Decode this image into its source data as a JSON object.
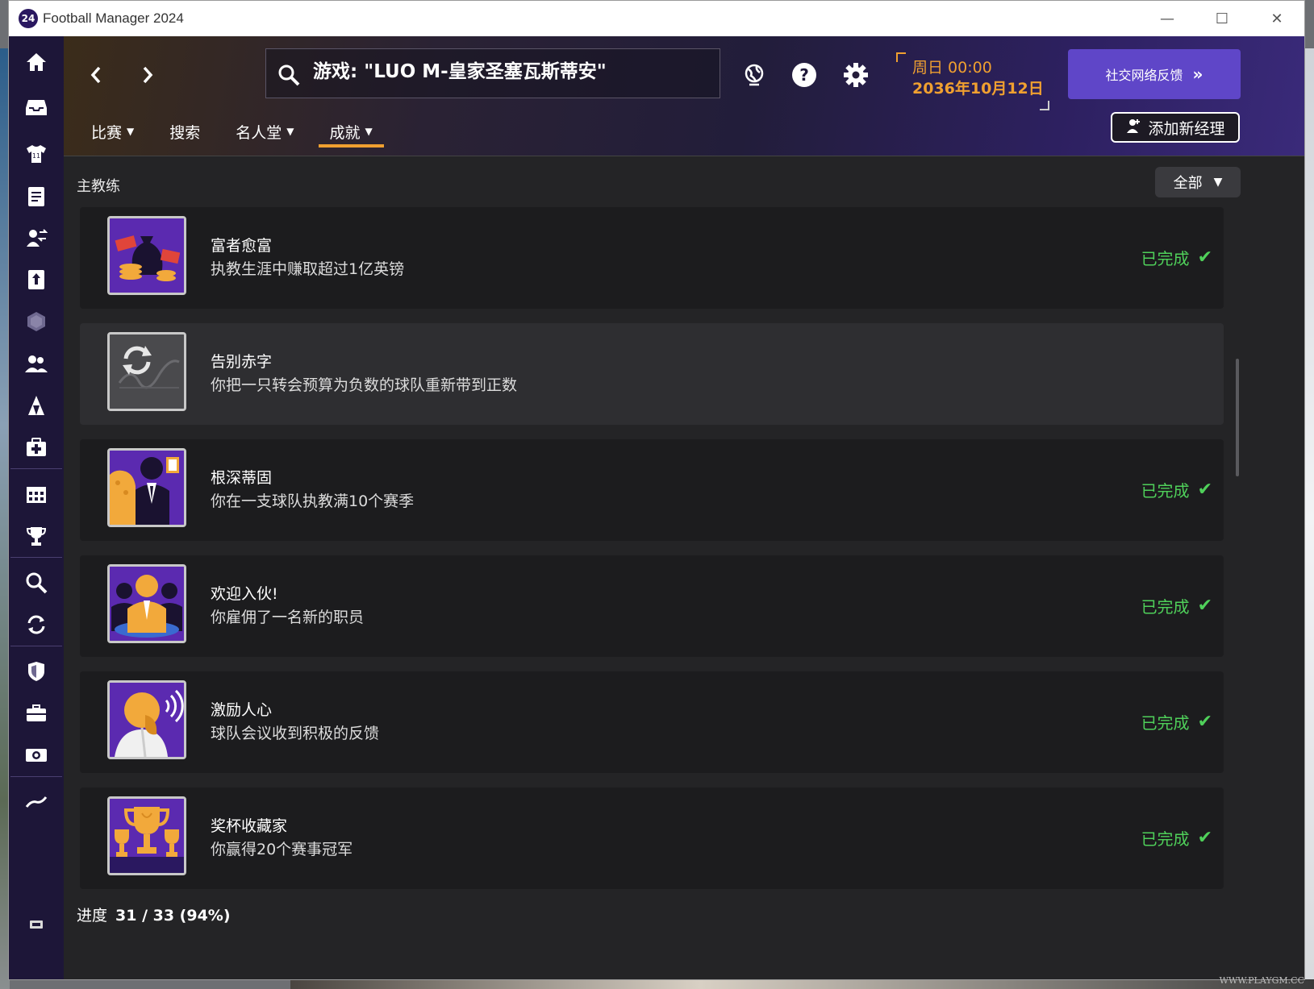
{
  "window": {
    "logo_text": "24",
    "title": "Football Manager 2024",
    "controls": [
      "—",
      "☐",
      "✕"
    ]
  },
  "header": {
    "search_text": "游戏: \"LUO M-皇家圣塞瓦斯蒂安\"",
    "date_day": "周日 00:00",
    "date_date": "2036年10月12日",
    "social_label": "社交网络反馈",
    "add_manager_label": "添加新经理",
    "tabs": [
      {
        "label": "比赛",
        "dropdown": true
      },
      {
        "label": "搜索",
        "dropdown": false
      },
      {
        "label": "名人堂",
        "dropdown": true
      },
      {
        "label": "成就",
        "dropdown": true,
        "active": true
      }
    ]
  },
  "section": {
    "title": "主教练",
    "filter_label": "全部"
  },
  "achievements": [
    {
      "name": "富者愈富",
      "desc": "执教生涯中赚取超过1亿英镑",
      "status": "已完成",
      "icon": "money-bag-icon"
    },
    {
      "name": "告别赤字",
      "desc": "你把一只转会预算为负数的球队重新带到正数",
      "status": "",
      "icon": "refresh-chart-icon"
    },
    {
      "name": "根深蒂固",
      "desc": "你在一支球队执教满10个赛季",
      "status": "已完成",
      "icon": "manager-chair-icon"
    },
    {
      "name": "欢迎入伙!",
      "desc": "你雇佣了一名新的职员",
      "status": "已完成",
      "icon": "staff-group-icon"
    },
    {
      "name": "激励人心",
      "desc": "球队会议收到积极的反馈",
      "status": "已完成",
      "icon": "shouting-manager-icon"
    },
    {
      "name": "奖杯收藏家",
      "desc": "你赢得20个赛事冠军",
      "status": "已完成",
      "icon": "trophies-icon"
    }
  ],
  "footer": {
    "progress_label": "进度",
    "progress_value": "31 / 33 (94%)"
  },
  "watermark": "WWW.PLAYGM.CC",
  "colors": {
    "accent_orange": "#f0a030",
    "complete_green": "#4fd05a",
    "brand_purple": "#5f46c8",
    "sidebar": "#1d1638"
  }
}
